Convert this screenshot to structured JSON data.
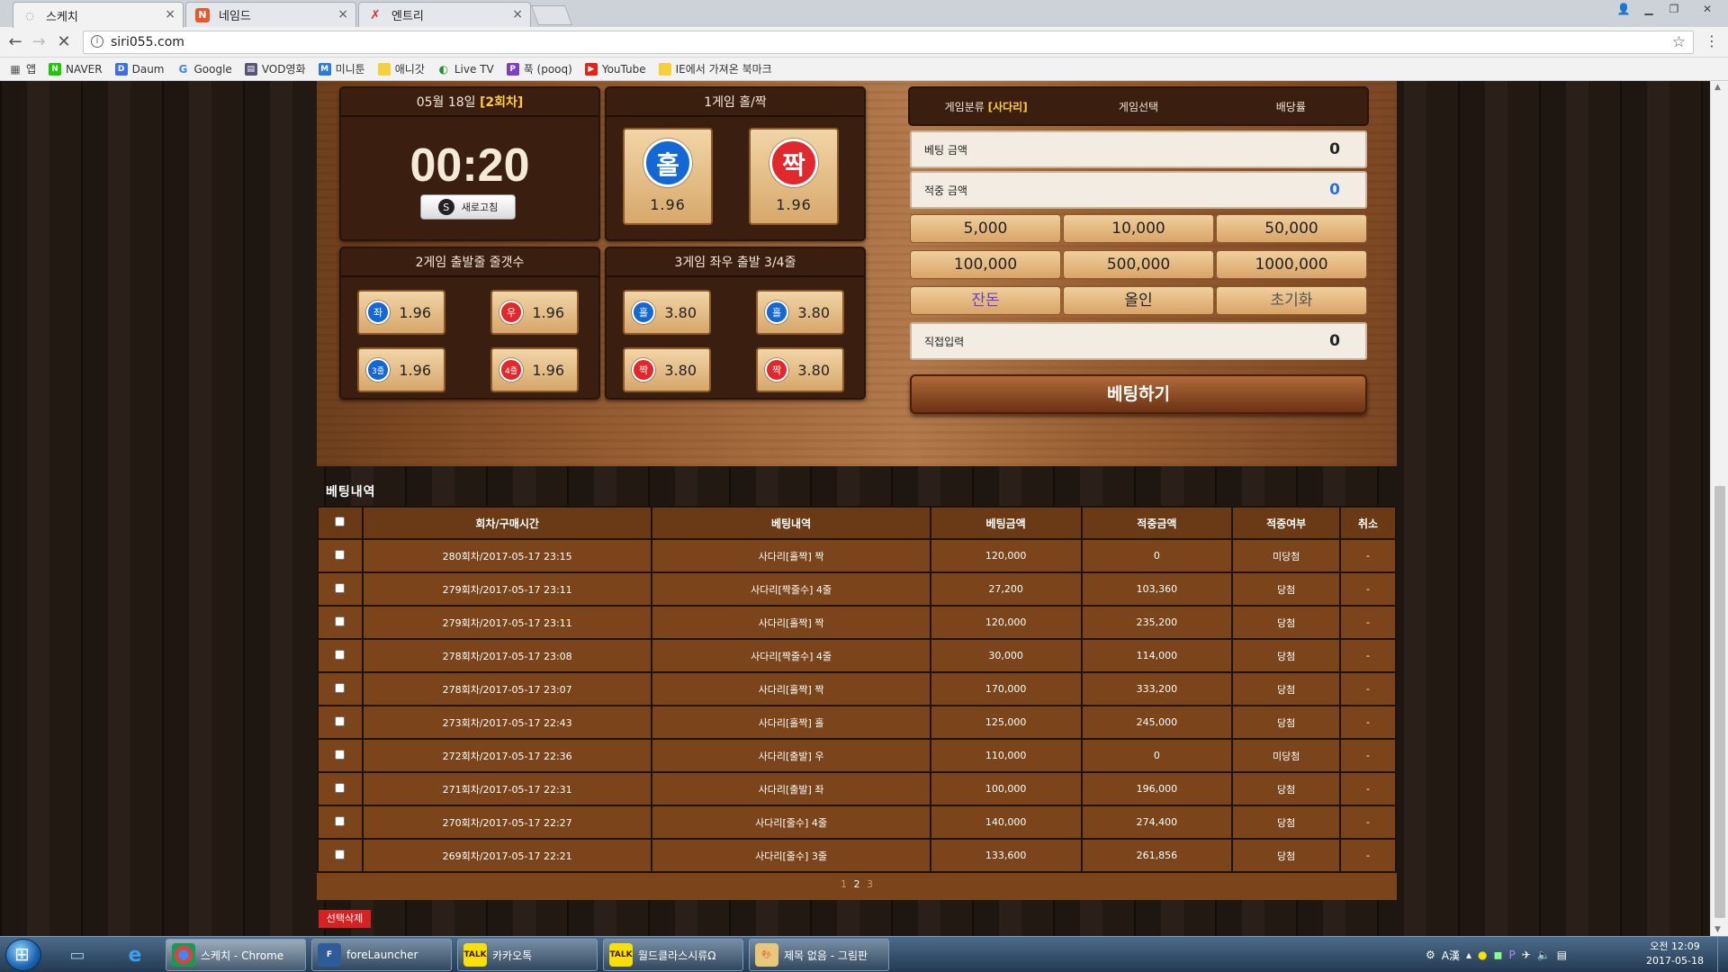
{
  "browser": {
    "tabs": [
      {
        "label": "스케치",
        "active": true
      },
      {
        "label": "네임드",
        "active": false
      },
      {
        "label": "엔트리",
        "active": false
      }
    ],
    "url": "siri055.com",
    "bookmarks": [
      "앱",
      "NAVER",
      "Daum",
      "Google",
      "VOD영화",
      "미니툰",
      "애니갓",
      "Live TV",
      "푹 (pooq)",
      "YouTube",
      "IE에서 가져온 북마크"
    ]
  },
  "game": {
    "round_date": "05월 18일",
    "round_label": "[2회차]",
    "timer": "00:20",
    "refresh_label": "새로고침",
    "game1": {
      "title": "1게임 홀/짝",
      "buttons": [
        {
          "ball": "홀",
          "odds": "1.96"
        },
        {
          "ball": "짝",
          "odds": "1.96"
        }
      ]
    },
    "game2": {
      "title": "2게임 출발줄 줄갯수",
      "buttons": [
        {
          "ball": "좌",
          "odds": "1.96"
        },
        {
          "ball": "우",
          "odds": "1.96"
        },
        {
          "ball": "3줄",
          "odds": "1.96"
        },
        {
          "ball": "4줄",
          "odds": "1.96"
        }
      ]
    },
    "game3": {
      "title": "3게임 좌우 출발 3/4줄",
      "buttons": [
        {
          "ball": "홀",
          "odds": "3.80"
        },
        {
          "ball": "홀",
          "odds": "3.80"
        },
        {
          "ball": "짝",
          "odds": "3.80"
        },
        {
          "ball": "짝",
          "odds": "3.80"
        }
      ]
    }
  },
  "bet": {
    "header": {
      "category_label": "게임분류",
      "category_value": "[사다리]",
      "select_label": "게임선택",
      "odds_label": "배당률"
    },
    "amount_label": "베팅 금액",
    "amount_value": "0",
    "win_label": "적중 금액",
    "win_value": "0",
    "chips": [
      "5,000",
      "10,000",
      "50,000",
      "100,000",
      "500,000",
      "1000,000"
    ],
    "actions": [
      "잔돈",
      "올인",
      "초기화"
    ],
    "direct_label": "직접입력",
    "direct_value": "0",
    "submit_label": "베팅하기"
  },
  "history": {
    "title": "베팅내역",
    "columns": [
      "회차/구매시간",
      "베팅내역",
      "베팅금액",
      "적중금액",
      "적중여부",
      "취소"
    ],
    "rows": [
      [
        "280회차/2017-05-17 23:15",
        "사다리[홀짝] 짝",
        "120,000",
        "0",
        "미당첨",
        "-"
      ],
      [
        "279회차/2017-05-17 23:11",
        "사다리[짝줄수] 4줄",
        "27,200",
        "103,360",
        "당첨",
        "-"
      ],
      [
        "279회차/2017-05-17 23:11",
        "사다리[홀짝] 짝",
        "120,000",
        "235,200",
        "당첨",
        "-"
      ],
      [
        "278회차/2017-05-17 23:08",
        "사다리[짝줄수] 4줄",
        "30,000",
        "114,000",
        "당첨",
        "-"
      ],
      [
        "278회차/2017-05-17 23:07",
        "사다리[홀짝] 짝",
        "170,000",
        "333,200",
        "당첨",
        "-"
      ],
      [
        "273회차/2017-05-17 22:43",
        "사다리[홀짝] 홀",
        "125,000",
        "245,000",
        "당첨",
        "-"
      ],
      [
        "272회차/2017-05-17 22:36",
        "사다리[출발] 우",
        "110,000",
        "0",
        "미당첨",
        "-"
      ],
      [
        "271회차/2017-05-17 22:31",
        "사다리[출발] 좌",
        "100,000",
        "196,000",
        "당첨",
        "-"
      ],
      [
        "270회차/2017-05-17 22:27",
        "사다리[줄수] 4줄",
        "140,000",
        "274,400",
        "당첨",
        "-"
      ],
      [
        "269회차/2017-05-17 22:21",
        "사다리[줄수] 3줄",
        "133,600",
        "261,856",
        "당첨",
        "-"
      ]
    ],
    "pages": [
      "1",
      "2",
      "3"
    ],
    "current_page": "2",
    "delete_label": "선택삭제"
  },
  "taskbar": {
    "items": [
      "스케치 - Chrome",
      "foreLauncher",
      "카카오톡",
      "월드클라스시류Ω",
      "제목 없음 - 그림판"
    ],
    "clock_time": "오전 12:09",
    "clock_date": "2017-05-18"
  }
}
